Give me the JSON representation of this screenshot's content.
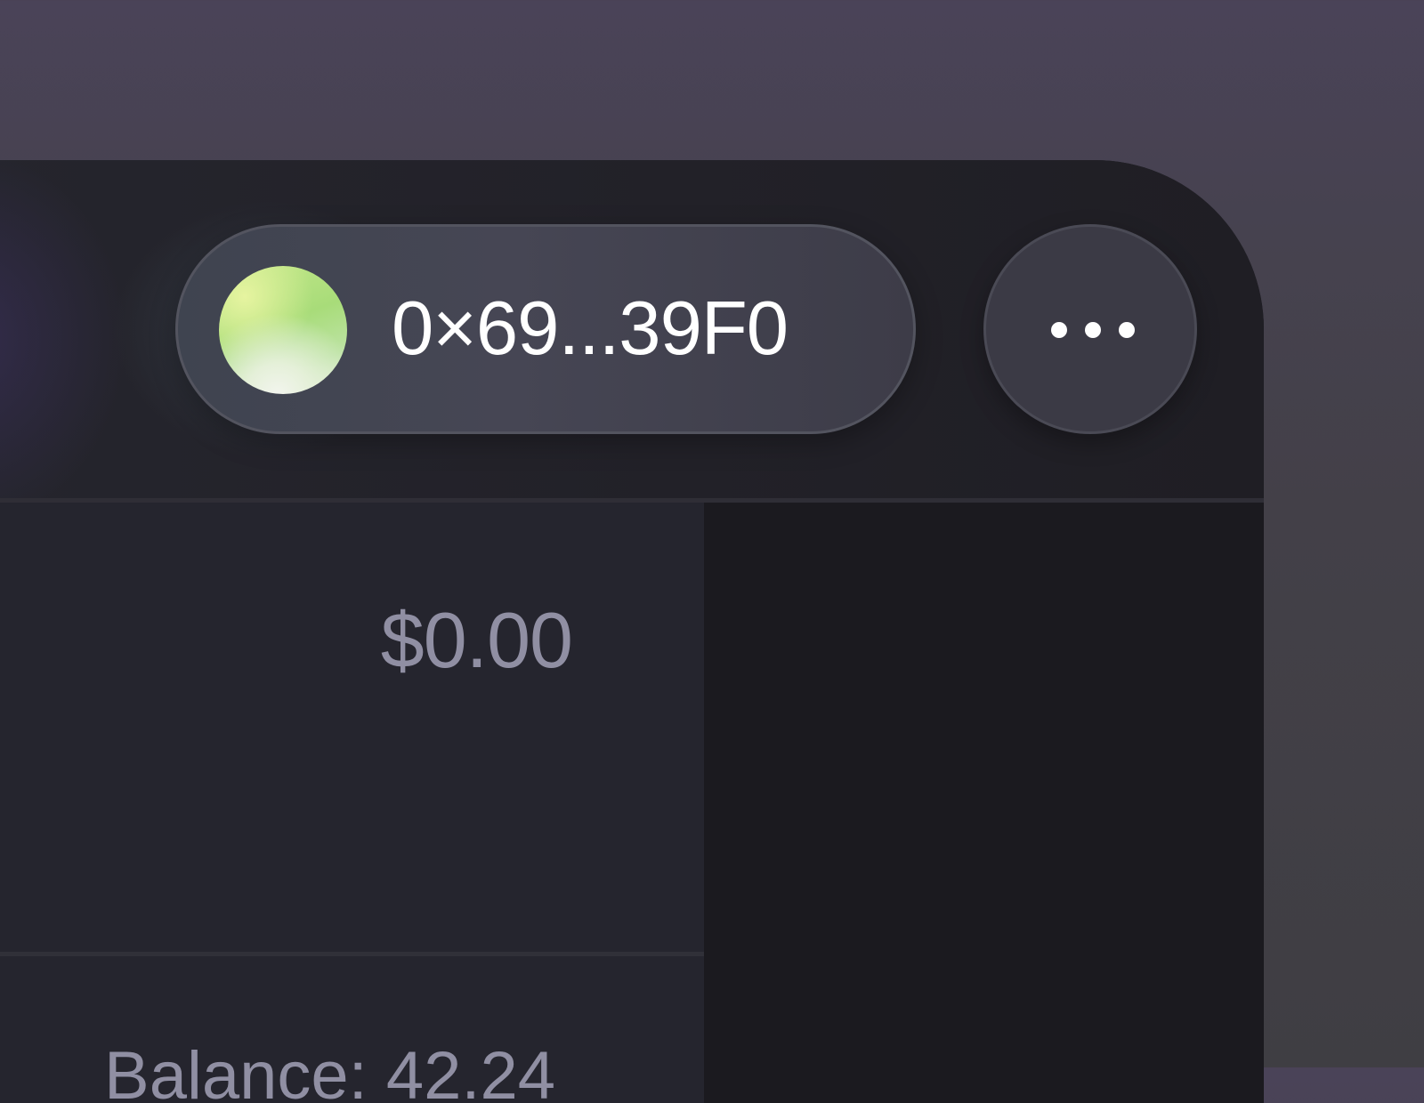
{
  "wallet": {
    "address": "0×69...39F0",
    "avatar_icon": "wallet-avatar-gradient",
    "colors": {
      "avatar_start": "#c4e88a",
      "avatar_end": "#e8f0e2"
    }
  },
  "menu": {
    "icon": "more-horizontal-icon"
  },
  "swap": {
    "amount_value": "$0.00",
    "balance_text": "Balance: 42.24"
  },
  "colors": {
    "background_top": "#4a4358",
    "background_bottom": "#3f3e43",
    "window": "#1c1b21",
    "panel": "#25252e",
    "secondary_text": "#908fa3",
    "primary_text": "#ffffff"
  }
}
